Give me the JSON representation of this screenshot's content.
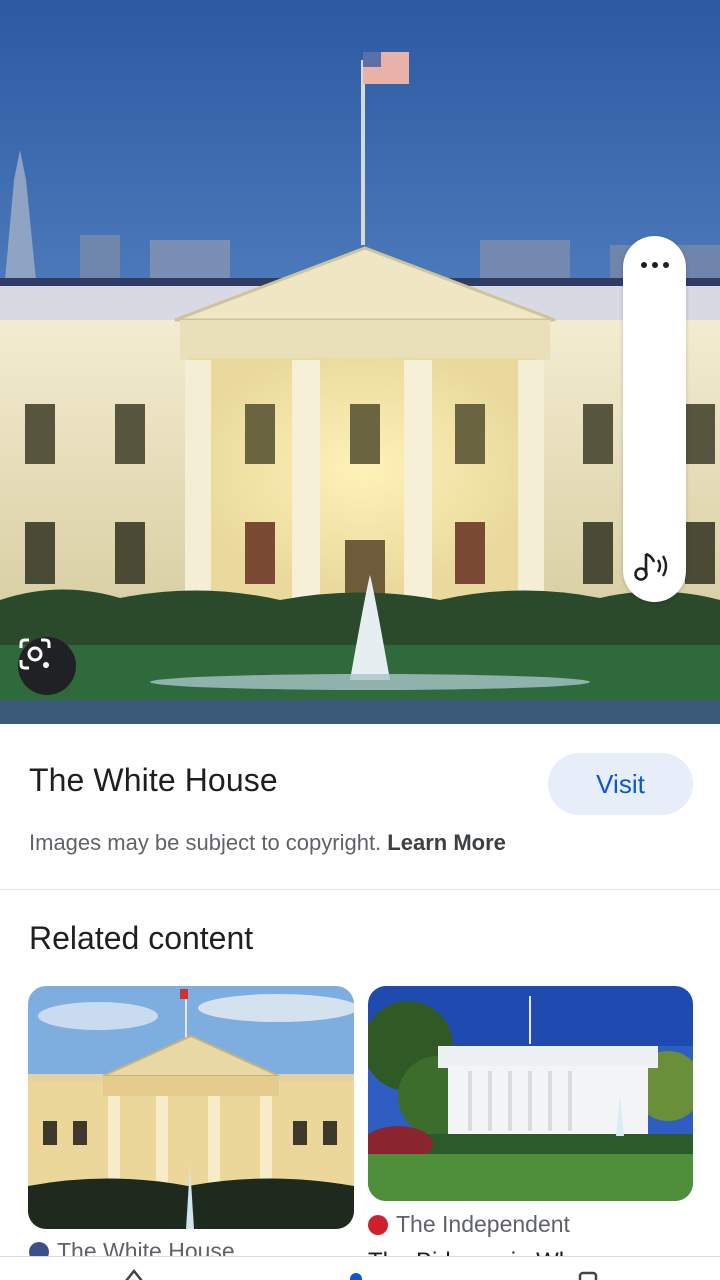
{
  "hero": {
    "alt": "The White House",
    "colors": {
      "sky": "#3f76c4",
      "facade": "#efe6c2",
      "lawn": "#2f6a3c"
    }
  },
  "side_actions": {
    "more_icon": "more-horizontal-icon",
    "audio_icon": "audio-music-icon"
  },
  "lens_icon": "google-lens-icon",
  "title": "The White House",
  "visit_label": "Visit",
  "copyright": {
    "text": "Images may be subject to copyright. ",
    "link": "Learn More"
  },
  "related": {
    "heading": "Related content",
    "cards": [
      {
        "source": "The White House",
        "source_icon": "white-house-favicon",
        "subtitle": ""
      },
      {
        "source": "The Independent",
        "source_icon": "independent-favicon",
        "subtitle": "The Biden ... in Wh"
      }
    ]
  },
  "bottom_nav": [
    "home-icon",
    "discover-icon",
    "tabs-icon"
  ],
  "colors": {
    "accent": "#0b57d0",
    "visit_bg": "#e8eef9",
    "muted": "#5f6368"
  }
}
